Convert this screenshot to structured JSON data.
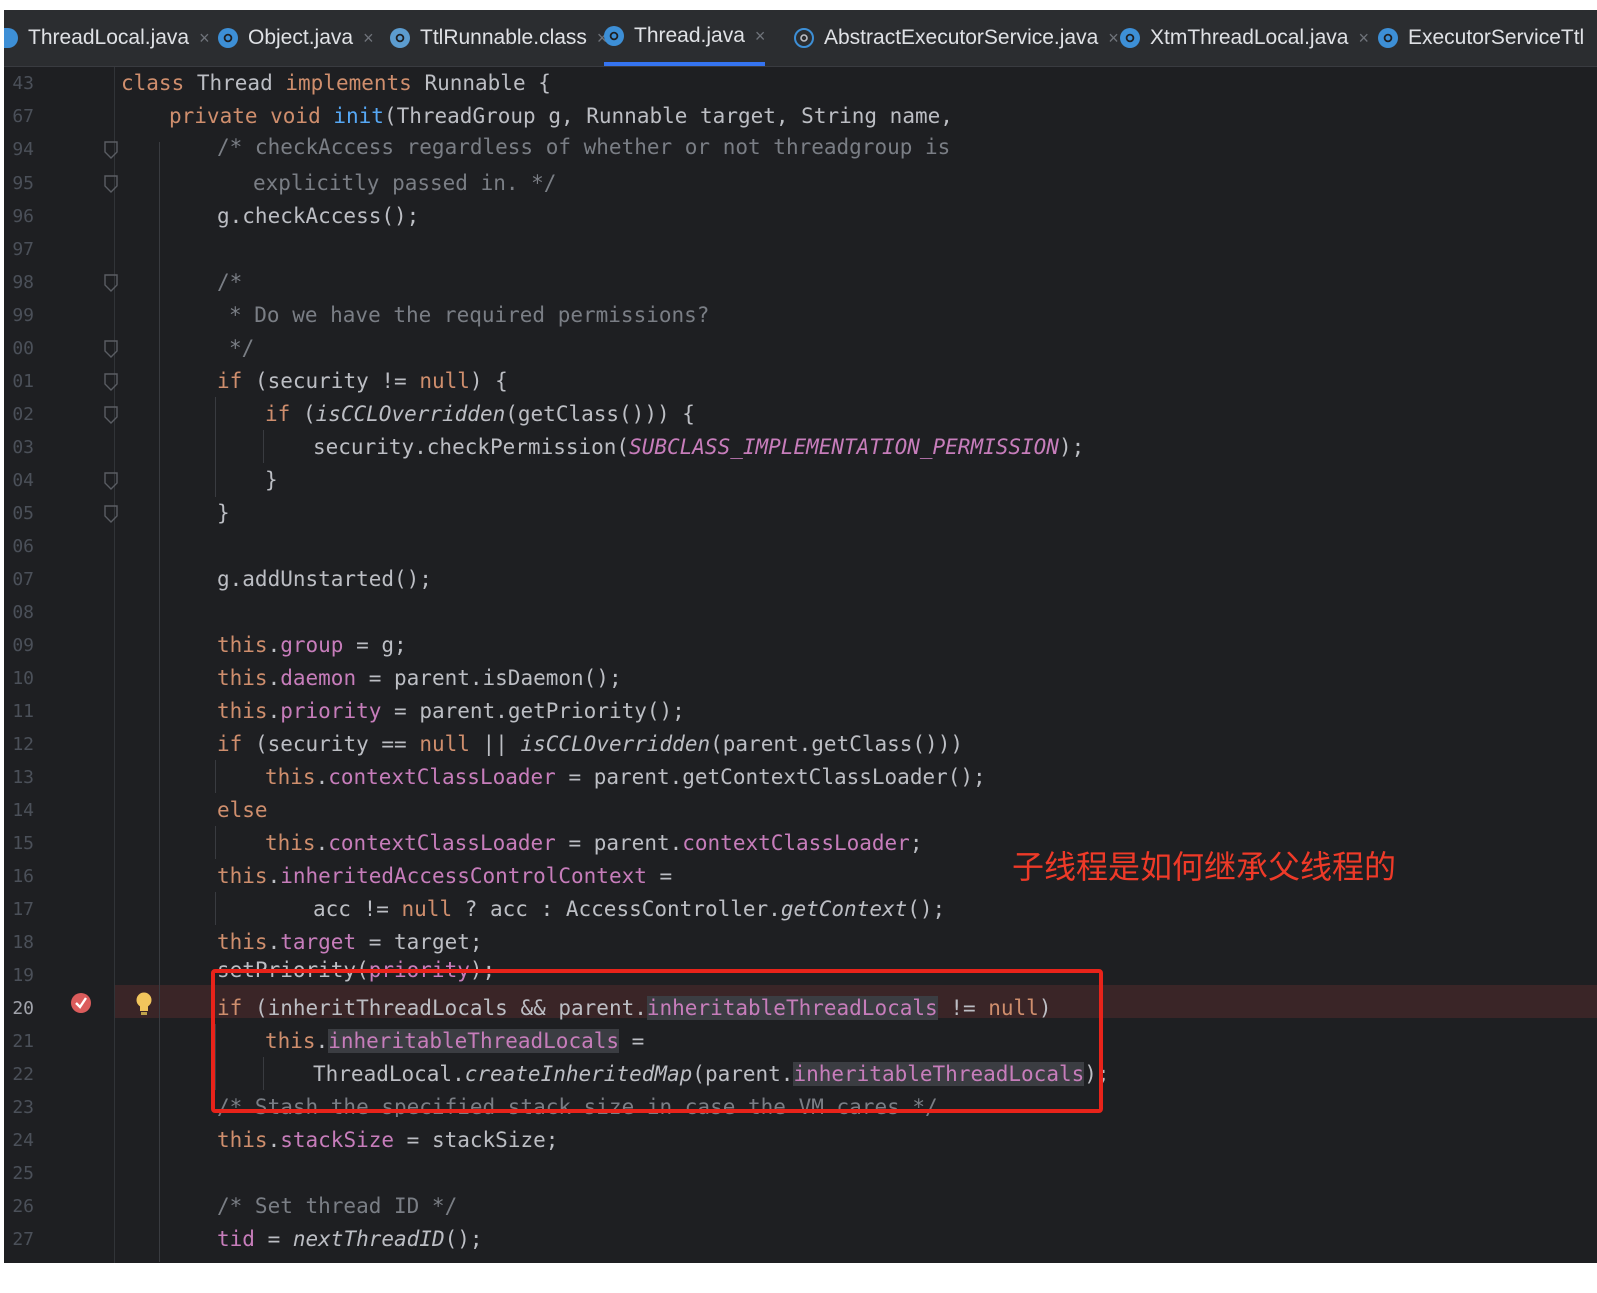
{
  "tabs": [
    {
      "label": "ThreadLocal.java",
      "active": false,
      "icon": "java-class-icon"
    },
    {
      "label": "Object.java",
      "active": false,
      "icon": "java-class-icon"
    },
    {
      "label": "TtlRunnable.class",
      "active": false,
      "icon": "compiled-class-icon"
    },
    {
      "label": "Thread.java",
      "active": true,
      "icon": "java-class-icon"
    },
    {
      "label": "AbstractExecutorService.java",
      "active": false,
      "icon": "abstract-class-icon"
    },
    {
      "label": "XtmThreadLocal.java",
      "active": false,
      "icon": "java-class-icon"
    },
    {
      "label": "ExecutorServiceTtl",
      "active": false,
      "icon": "java-class-icon"
    }
  ],
  "line_numbers": [
    "43",
    "67",
    "94",
    "95",
    "96",
    "97",
    "98",
    "99",
    "00",
    "01",
    "02",
    "03",
    "04",
    "05",
    "06",
    "07",
    "08",
    "09",
    "10",
    "11",
    "12",
    "13",
    "14",
    "15",
    "16",
    "17",
    "18",
    "19",
    "20",
    "21",
    "22",
    "23",
    "24",
    "25",
    "26",
    "27"
  ],
  "code": {
    "l0": {
      "a": "class ",
      "b": "Thread ",
      "c": "implements ",
      "d": "Runnable {"
    },
    "l1": {
      "a": "private void ",
      "b": "init",
      "c": "(ThreadGroup g, Runnable target, String name,"
    },
    "l2": "/* checkAccess regardless of whether or not threadgroup is",
    "l3": "explicitly passed in. */",
    "l4": "g.checkAccess();",
    "l6": "/*",
    "l7": "* Do we have the required permissions?",
    "l8": "*/",
    "l9": {
      "a": "if ",
      "b": "(security != ",
      "c": "null",
      "d": ") {"
    },
    "l10": {
      "a": "if ",
      "b": "(",
      "c": "isCCLOverridden",
      "d": "(getClass())) {"
    },
    "l11": {
      "a": "security.checkPermission(",
      "b": "SUBCLASS_IMPLEMENTATION_PERMISSION",
      "c": ");"
    },
    "l12": "}",
    "l13": "}",
    "l15": "g.addUnstarted();",
    "l17": {
      "a": "this",
      "b": ".",
      "c": "group",
      "d": " = g;"
    },
    "l18": {
      "a": "this",
      "b": ".",
      "c": "daemon",
      "d": " = parent.isDaemon();"
    },
    "l19": {
      "a": "this",
      "b": ".",
      "c": "priority",
      "d": " = parent.getPriority();"
    },
    "l20": {
      "a": "if ",
      "b": "(security == ",
      "c": "null",
      "d": " || ",
      "e": "isCCLOverridden",
      "f": "(parent.getClass()))"
    },
    "l21": {
      "a": "this",
      "b": ".",
      "c": "contextClassLoader",
      "d": " = parent.getContextClassLoader();"
    },
    "l22": "else",
    "l23": {
      "a": "this",
      "b": ".",
      "c": "contextClassLoader",
      "d": " = parent.",
      "e": "contextClassLoader",
      "f": ";"
    },
    "l24": {
      "a": "this",
      "b": ".",
      "c": "inheritedAccessControlContext",
      "d": " ="
    },
    "l25": {
      "a": "acc != ",
      "b": "null",
      "c": " ? acc : AccessController.",
      "d": "getContext",
      "e": "();"
    },
    "l26": {
      "a": "this",
      "b": ".",
      "c": "target",
      "d": " = target;"
    },
    "l27": {
      "a": "setPriority(",
      "b": "priority",
      "c": ");"
    },
    "l28": {
      "a": "if ",
      "b": "(inheritThreadLocals && parent.",
      "c": "inheritableThreadLocals",
      "d": " != ",
      "e": "null",
      "f": ")"
    },
    "l29": {
      "a": "this",
      "b": ".",
      "c": "inheritableThreadLocals",
      "d": " ="
    },
    "l30": {
      "a": "ThreadLocal.",
      "b": "createInheritedMap",
      "c": "(parent.",
      "d": "inheritableThreadLocals",
      "e": ");"
    },
    "l31": "/* Stash the specified stack size in case the VM cares */",
    "l32": {
      "a": "this",
      "b": ".",
      "c": "stackSize",
      "d": " = stackSize;"
    },
    "l34": "/* Set thread ID */",
    "l35": {
      "a": "tid",
      "b": " = ",
      "c": "nextThreadID",
      "d": "();"
    }
  },
  "annotation": "子线程是如何继承父线程的",
  "colors": {
    "keyword": "#cf8e6d",
    "field": "#c77dbb",
    "comment": "#7a7e85",
    "method_decl": "#56a8f5",
    "annotation_red": "#ee3a28",
    "background": "#1e1f22"
  }
}
